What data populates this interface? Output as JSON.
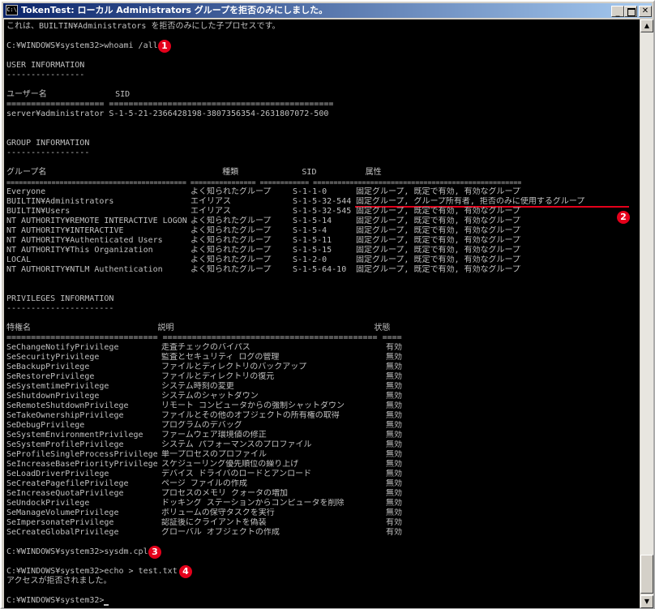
{
  "window": {
    "title": "TokenTest: ローカル Administrators グループを拒否のみにしました。"
  },
  "colors": {
    "titlebar_start": "#0a246a",
    "titlebar_end": "#a6caf0",
    "console_bg": "#000000",
    "console_text": "#c0c0c0",
    "annotation": "#e4001b"
  },
  "icons": [
    "console-app-icon",
    "minimize-icon",
    "maximize-icon",
    "close-icon",
    "scroll-up-icon",
    "scroll-down-icon"
  ],
  "console": {
    "intro": "これは、BUILTIN¥Administrators を拒否のみにした子プロセスです。",
    "cmd1": "C:¥WINDOWS¥system32>whoami /all",
    "user_info": {
      "title": "USER INFORMATION",
      "underline": "----------------",
      "header": "ユーザー名              SID",
      "separator": "==================== ==============================================",
      "row": "server¥administrator S-1-5-21-2366428198-3807356354-2631807072-500"
    },
    "group_info": {
      "title": "GROUP INFORMATION",
      "underline": "-----------------",
      "header": "グループ名                                    種類             SID          属性",
      "separator": "============================================ ================ ============ ===================================================",
      "rows": [
        {
          "name": "Everyone",
          "type": "よく知られたグループ",
          "sid": "S-1-1-0",
          "attr": "固定グループ, 既定で有効, 有効なグループ"
        },
        {
          "name": "BUILTIN¥Administrators",
          "type": "エイリアス",
          "sid": "S-1-5-32-544",
          "attr": "固定グループ, グループ所有者, 拒否のみに使用するグループ"
        },
        {
          "name": "BUILTIN¥Users",
          "type": "エイリアス",
          "sid": "S-1-5-32-545",
          "attr": "固定グループ, 既定で有効, 有効なグループ"
        },
        {
          "name": "NT AUTHORITY¥REMOTE INTERACTIVE LOGON",
          "type": "よく知られたグループ",
          "sid": "S-1-5-14",
          "attr": "固定グループ, 既定で有効, 有効なグループ"
        },
        {
          "name": "NT AUTHORITY¥INTERACTIVE",
          "type": "よく知られたグループ",
          "sid": "S-1-5-4",
          "attr": "固定グループ, 既定で有効, 有効なグループ"
        },
        {
          "name": "NT AUTHORITY¥Authenticated Users",
          "type": "よく知られたグループ",
          "sid": "S-1-5-11",
          "attr": "固定グループ, 既定で有効, 有効なグループ"
        },
        {
          "name": "NT AUTHORITY¥This Organization",
          "type": "よく知られたグループ",
          "sid": "S-1-5-15",
          "attr": "固定グループ, 既定で有効, 有効なグループ"
        },
        {
          "name": "LOCAL",
          "type": "よく知られたグループ",
          "sid": "S-1-2-0",
          "attr": "固定グループ, 既定で有効, 有効なグループ"
        },
        {
          "name": "NT AUTHORITY¥NTLM Authentication",
          "type": "よく知られたグループ",
          "sid": "S-1-5-64-10",
          "attr": "固定グループ, 既定で有効, 有効なグループ"
        }
      ]
    },
    "priv_info": {
      "title": "PRIVILEGES INFORMATION",
      "underline": "----------------------",
      "header": "特権名                          説明                                         状態",
      "separator": "=============================== ============================================ ====",
      "rows": [
        {
          "name": "SeChangeNotifyPrivilege",
          "desc": "走査チェックのバイパス",
          "state": "有効"
        },
        {
          "name": "SeSecurityPrivilege",
          "desc": "監査とセキュリティ ログの管理",
          "state": "無効"
        },
        {
          "name": "SeBackupPrivilege",
          "desc": "ファイルとディレクトリのバックアップ",
          "state": "無効"
        },
        {
          "name": "SeRestorePrivilege",
          "desc": "ファイルとディレクトリの復元",
          "state": "無効"
        },
        {
          "name": "SeSystemtimePrivilege",
          "desc": "システム時刻の変更",
          "state": "無効"
        },
        {
          "name": "SeShutdownPrivilege",
          "desc": "システムのシャットダウン",
          "state": "無効"
        },
        {
          "name": "SeRemoteShutdownPrivilege",
          "desc": "リモート コンピュータからの強制シャットダウン",
          "state": "無効"
        },
        {
          "name": "SeTakeOwnershipPrivilege",
          "desc": "ファイルとその他のオブジェクトの所有権の取得",
          "state": "無効"
        },
        {
          "name": "SeDebugPrivilege",
          "desc": "プログラムのデバッグ",
          "state": "無効"
        },
        {
          "name": "SeSystemEnvironmentPrivilege",
          "desc": "ファームウェア環境値の修正",
          "state": "無効"
        },
        {
          "name": "SeSystemProfilePrivilege",
          "desc": "システム パフォーマンスのプロファイル",
          "state": "無効"
        },
        {
          "name": "SeProfileSingleProcessPrivilege",
          "desc": "単一プロセスのプロファイル",
          "state": "無効"
        },
        {
          "name": "SeIncreaseBasePriorityPrivilege",
          "desc": "スケジューリング優先順位の繰り上げ",
          "state": "無効"
        },
        {
          "name": "SeLoadDriverPrivilege",
          "desc": "デバイス ドライバのロードとアンロード",
          "state": "無効"
        },
        {
          "name": "SeCreatePagefilePrivilege",
          "desc": "ページ ファイルの作成",
          "state": "無効"
        },
        {
          "name": "SeIncreaseQuotaPrivilege",
          "desc": "プロセスのメモリ クォータの増加",
          "state": "無効"
        },
        {
          "name": "SeUndockPrivilege",
          "desc": "ドッキング ステーションからコンピュータを削除",
          "state": "無効"
        },
        {
          "name": "SeManageVolumePrivilege",
          "desc": "ボリュームの保守タスクを実行",
          "state": "無効"
        },
        {
          "name": "SeImpersonatePrivilege",
          "desc": "認証後にクライアントを偽装",
          "state": "有効"
        },
        {
          "name": "SeCreateGlobalPrivilege",
          "desc": "グローバル オブジェクトの作成",
          "state": "有効"
        }
      ]
    },
    "cmd2": "C:¥WINDOWS¥system32>sysdm.cpl",
    "cmd3": "C:¥WINDOWS¥system32>echo > test.txt",
    "error": "アクセスが拒否されました。",
    "prompt": "C:¥WINDOWS¥system32>"
  },
  "badges": [
    "1",
    "2",
    "3",
    "4"
  ]
}
